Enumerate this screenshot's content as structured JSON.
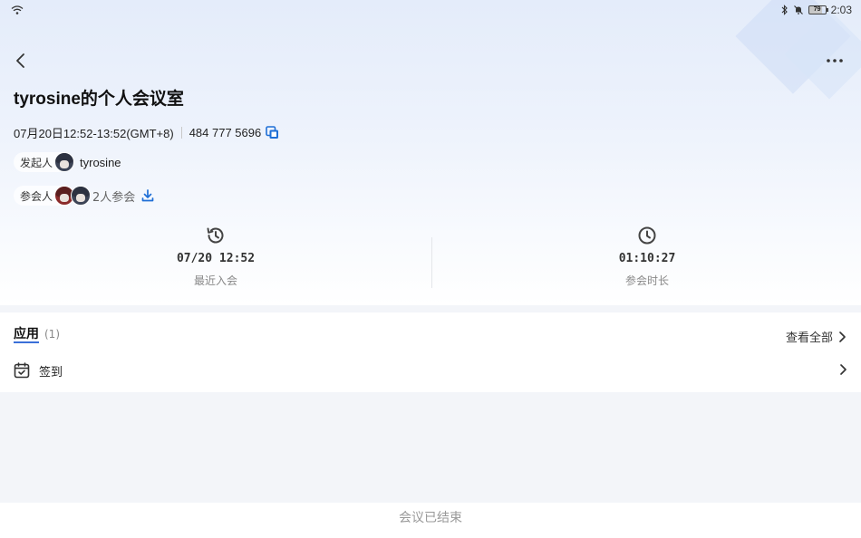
{
  "status_bar": {
    "time": "2:03",
    "battery": "79"
  },
  "meeting": {
    "title": "tyrosine的个人会议室",
    "time_range": "07月20日12:52-13:52(GMT+8)",
    "meeting_id": "484 777 5696"
  },
  "host": {
    "label": "发起人",
    "name": "tyrosine"
  },
  "participants": {
    "label": "参会人",
    "count_text": "2人参会"
  },
  "stats": [
    {
      "value": "07/20 12:52",
      "label": "最近入会"
    },
    {
      "value": "01:10:27",
      "label": "参会时长"
    }
  ],
  "apps": {
    "title": "应用",
    "count": "(1)",
    "view_all": "查看全部",
    "items": [
      {
        "label": "签到"
      }
    ]
  },
  "footer": {
    "status": "会议已结束"
  },
  "colors": {
    "accent": "#1f6fd6"
  }
}
